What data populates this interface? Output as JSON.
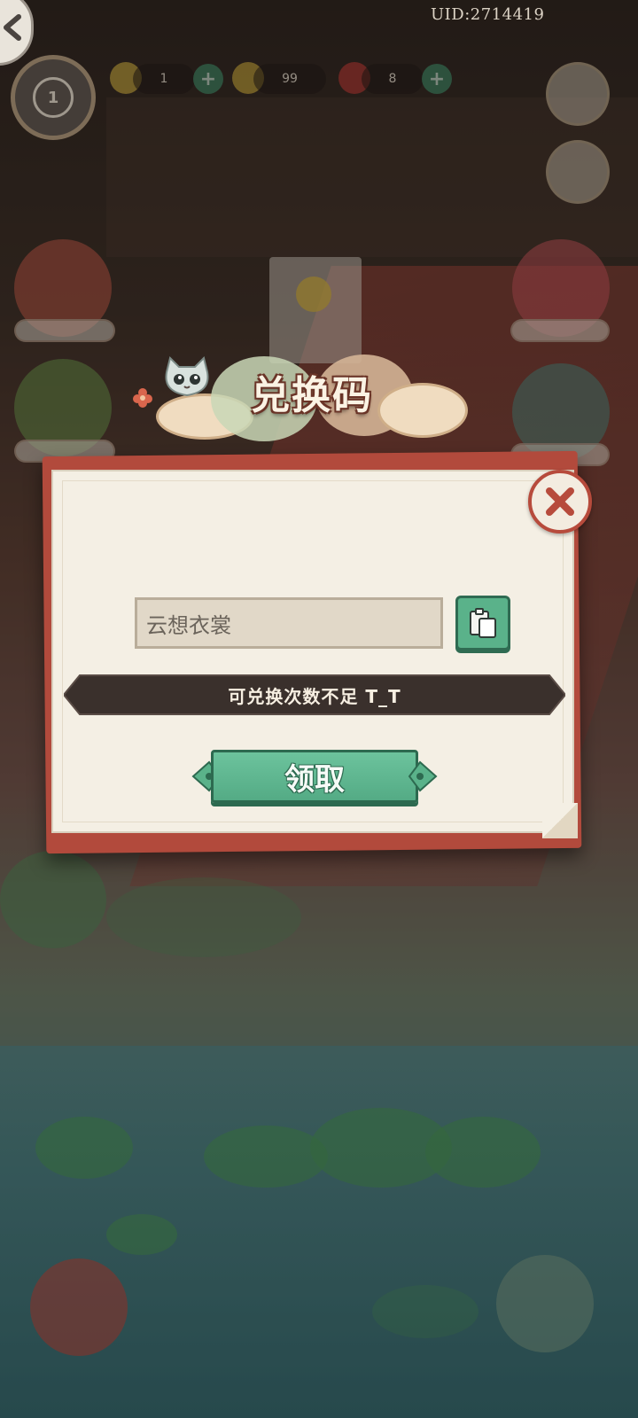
{
  "hud": {
    "uid": "UID:2714419",
    "level": "1",
    "resources": [
      {
        "name": "energy",
        "value": "1",
        "icon": "lightning-icon"
      },
      {
        "name": "coins",
        "value": "99",
        "icon": "coin-icon"
      },
      {
        "name": "gems",
        "value": "8",
        "icon": "red-gem-icon"
      }
    ]
  },
  "dialog": {
    "title": "兑换码",
    "input_value": "云想衣裳",
    "message": "可兑换次数不足 T_T",
    "claim_label": "领取"
  },
  "colors": {
    "frame_red": "#b24a3c",
    "paper": "#f4efe4",
    "button_green": "#5ab28a",
    "message_bar": "#3a302c"
  }
}
